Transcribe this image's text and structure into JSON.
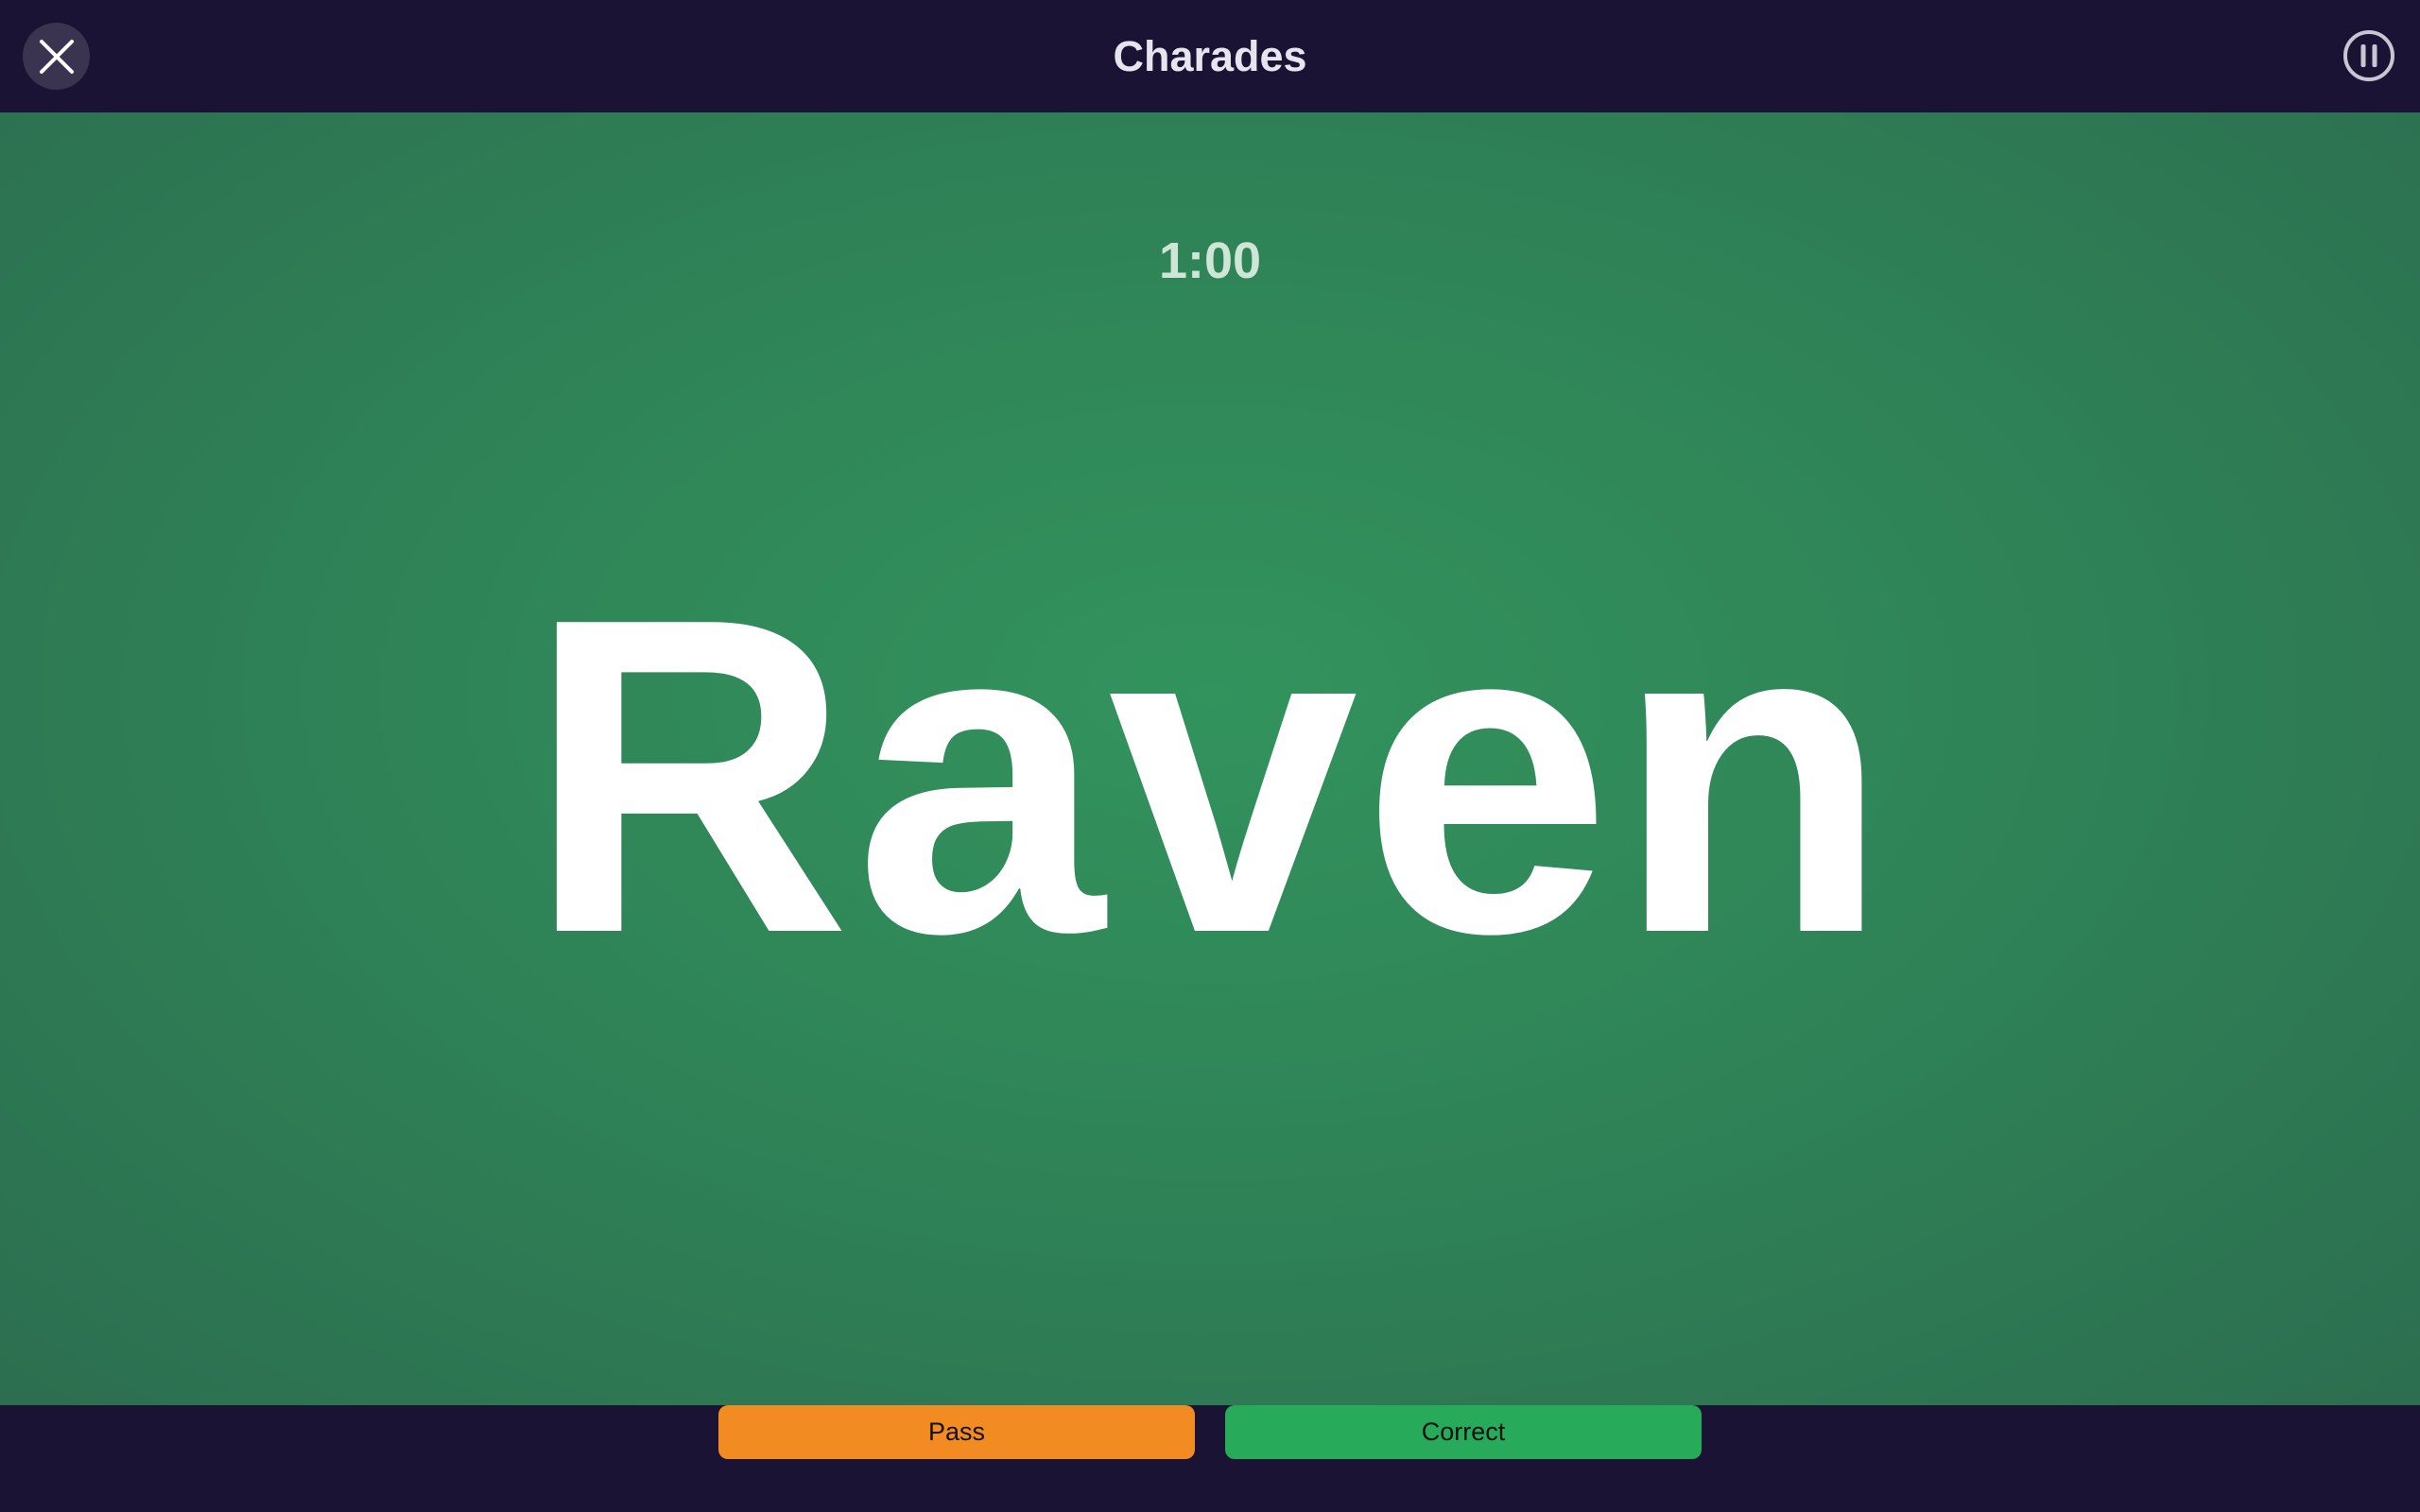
{
  "header": {
    "title": "Charades",
    "close_icon": "close-icon",
    "pause_icon": "pause-icon"
  },
  "game": {
    "timer": "1:00",
    "word": "Raven"
  },
  "actions": {
    "pass_label": "Pass",
    "correct_label": "Correct"
  },
  "colors": {
    "header_bg": "#1b1333",
    "stage_green": "#32935d",
    "pass": "#f28c22",
    "correct": "#27ab5a"
  }
}
